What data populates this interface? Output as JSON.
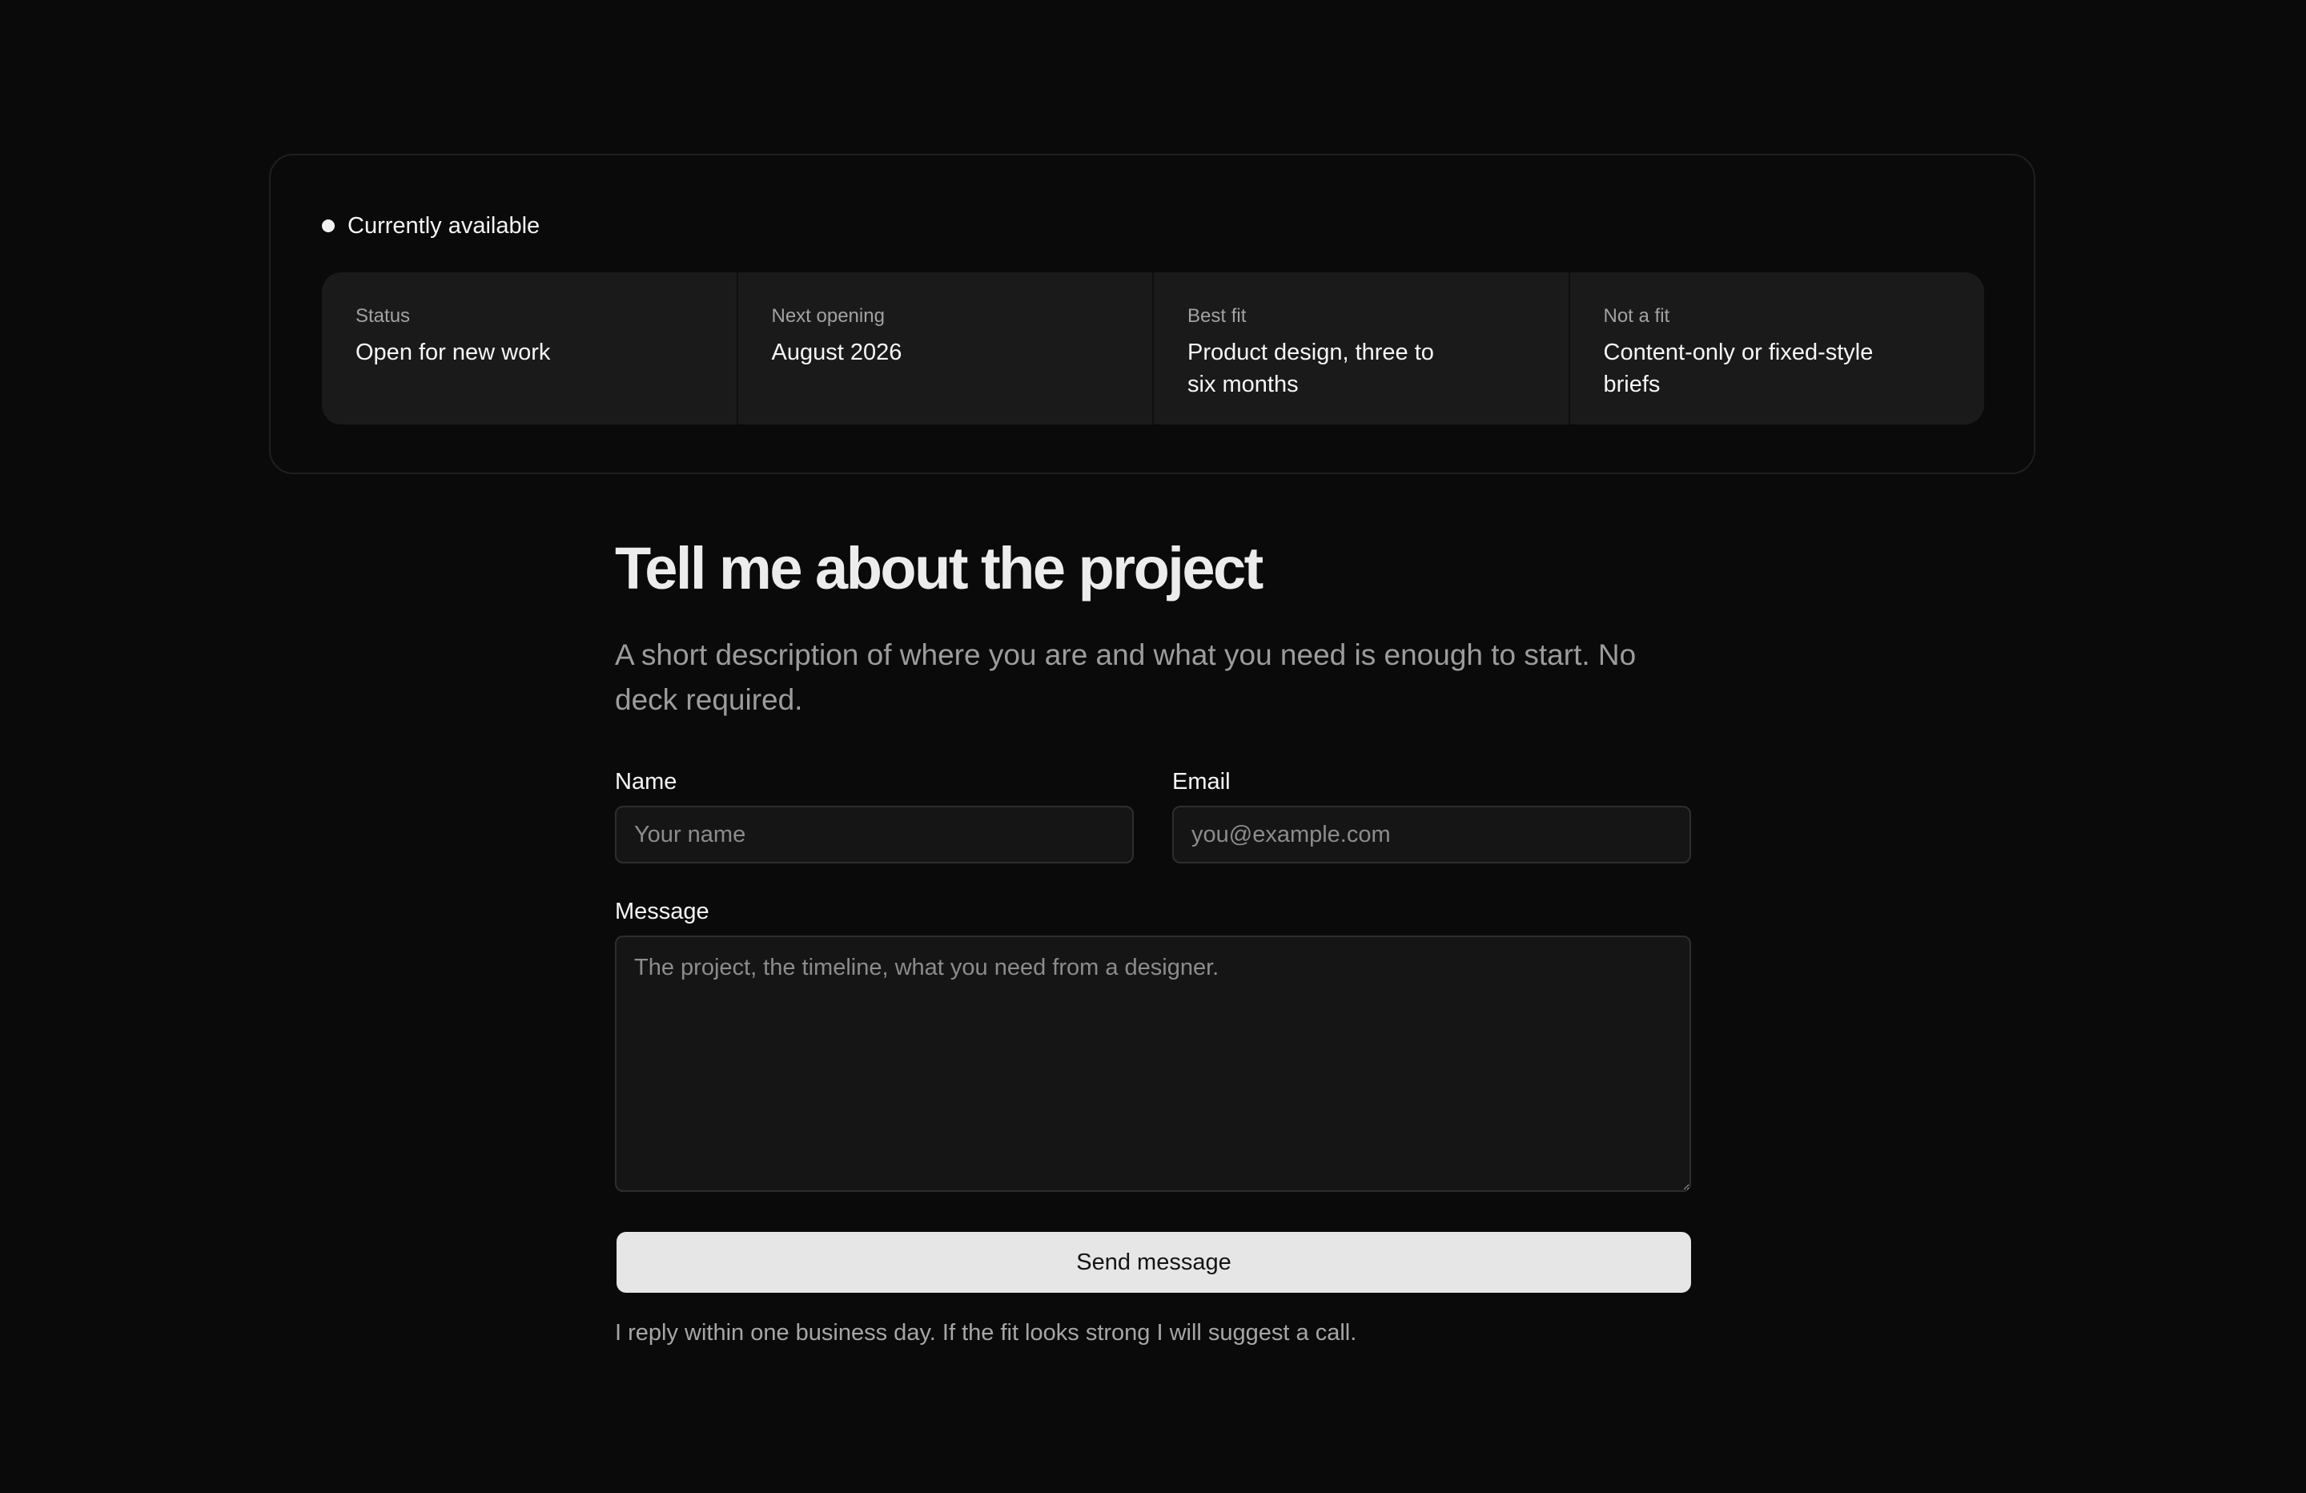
{
  "availability": {
    "label": "Currently available",
    "facts": [
      {
        "label": "Status",
        "value": "Open for new work"
      },
      {
        "label": "Next opening",
        "value": "August 2026"
      },
      {
        "label": "Best fit",
        "value": "Product design, three to six months"
      },
      {
        "label": "Not a fit",
        "value": "Content-only or fixed-style briefs"
      }
    ]
  },
  "form": {
    "title": "Tell me about the project",
    "subtitle": "A short description of where you are and what you need is enough to start. No deck required.",
    "name_label": "Name",
    "name_placeholder": "Your name",
    "email_label": "Email",
    "email_placeholder": "you@example.com",
    "message_label": "Message",
    "message_placeholder": "The project, the timeline, what you need from a designer.",
    "submit_label": "Send message",
    "note": "I reply within one business day. If the fit looks strong I will suggest a call."
  }
}
